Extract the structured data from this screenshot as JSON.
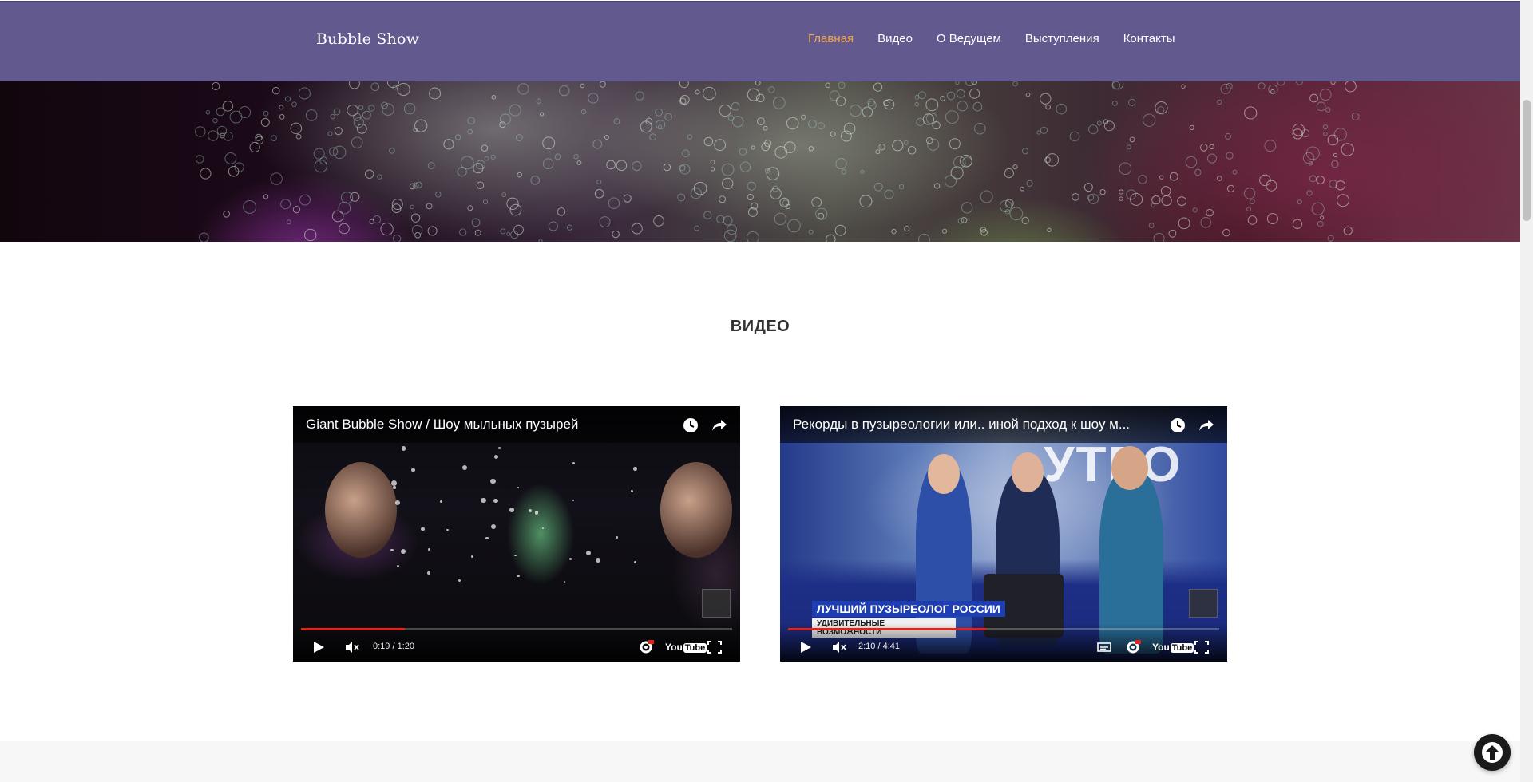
{
  "header": {
    "brand": "Bubble Show",
    "nav": [
      {
        "label": "Главная",
        "active": true
      },
      {
        "label": "Видео",
        "active": false
      },
      {
        "label": "О Ведущем",
        "active": false
      },
      {
        "label": "Выступления",
        "active": false
      },
      {
        "label": "Контакты",
        "active": false
      }
    ],
    "background_color": "#625a8e",
    "active_color": "#f2a545"
  },
  "video_section": {
    "title": "ВИДЕО",
    "videos": [
      {
        "title": "Giant Bubble Show / Шоу мыльных пузырей",
        "time": "0:19 / 1:20",
        "progress": 0.24,
        "youtube_logo": "You",
        "youtube_logo_box": "Tube"
      },
      {
        "title": "Рекорды в пузыреологии или.. иной подход к шоу м...",
        "time": "2:10 / 4:41",
        "progress": 0.46,
        "youtube_logo": "You",
        "youtube_logo_box": "Tube",
        "overlay_text": "УТРО",
        "lower_third": {
          "line1": "ЛУЧШИЙ ПУЗЫРЕОЛОГ РОССИИ",
          "line2": "УДИВИТЕЛЬНЫЕ ВОЗМОЖНОСТИ"
        }
      }
    ]
  },
  "icons": {
    "clock": "clock-icon",
    "share": "share-icon",
    "play": "play-icon",
    "mute": "mute-icon",
    "settings": "gear-icon",
    "fullscreen": "fullscreen-icon",
    "subtitles": "subtitles-icon",
    "back_to_top": "arrow-up-icon"
  }
}
